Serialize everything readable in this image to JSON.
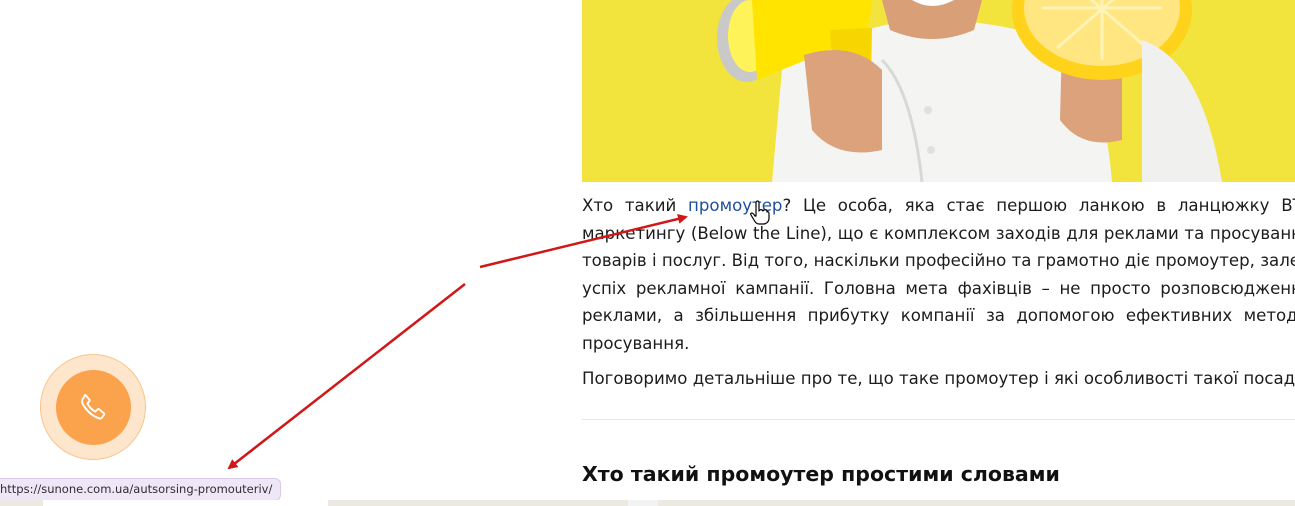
{
  "article": {
    "p1": {
      "before_link": "Хто такий ",
      "link_text": "промоутер",
      "link_url": "https://sunone.com.ua/autsorsing-promouteriv/",
      "lines": [
        "? Це особа, яка стає першою ланкою в ланцюжку BTL",
        "маркетингу (Below the Line), що є комплексом заходів для реклами та просування",
        "товарів і послуг. Від того, наскільки професійно та грамотно діє промоутер, залежить",
        "успіх рекламної кампанії. Головна мета фахівців – не просто розповсюдження",
        "реклами, а збільшення прибутку компанії за допомогою ефективних методів",
        "просування."
      ]
    },
    "p2": "Поговоримо детальніше про те, що таке промоутер і які особливості такої посади.",
    "heading": "Хто такий промоутер простими словами"
  },
  "status_bar": {
    "url": "https://sunone.com.ua/autsorsing-promouteriv/"
  },
  "call_button": {
    "icon": "phone-icon",
    "color": "#fba24d"
  },
  "colors": {
    "link": "#1f4f9a",
    "hero_background": "#f2e43c",
    "annotation_arrow": "#d01818"
  }
}
